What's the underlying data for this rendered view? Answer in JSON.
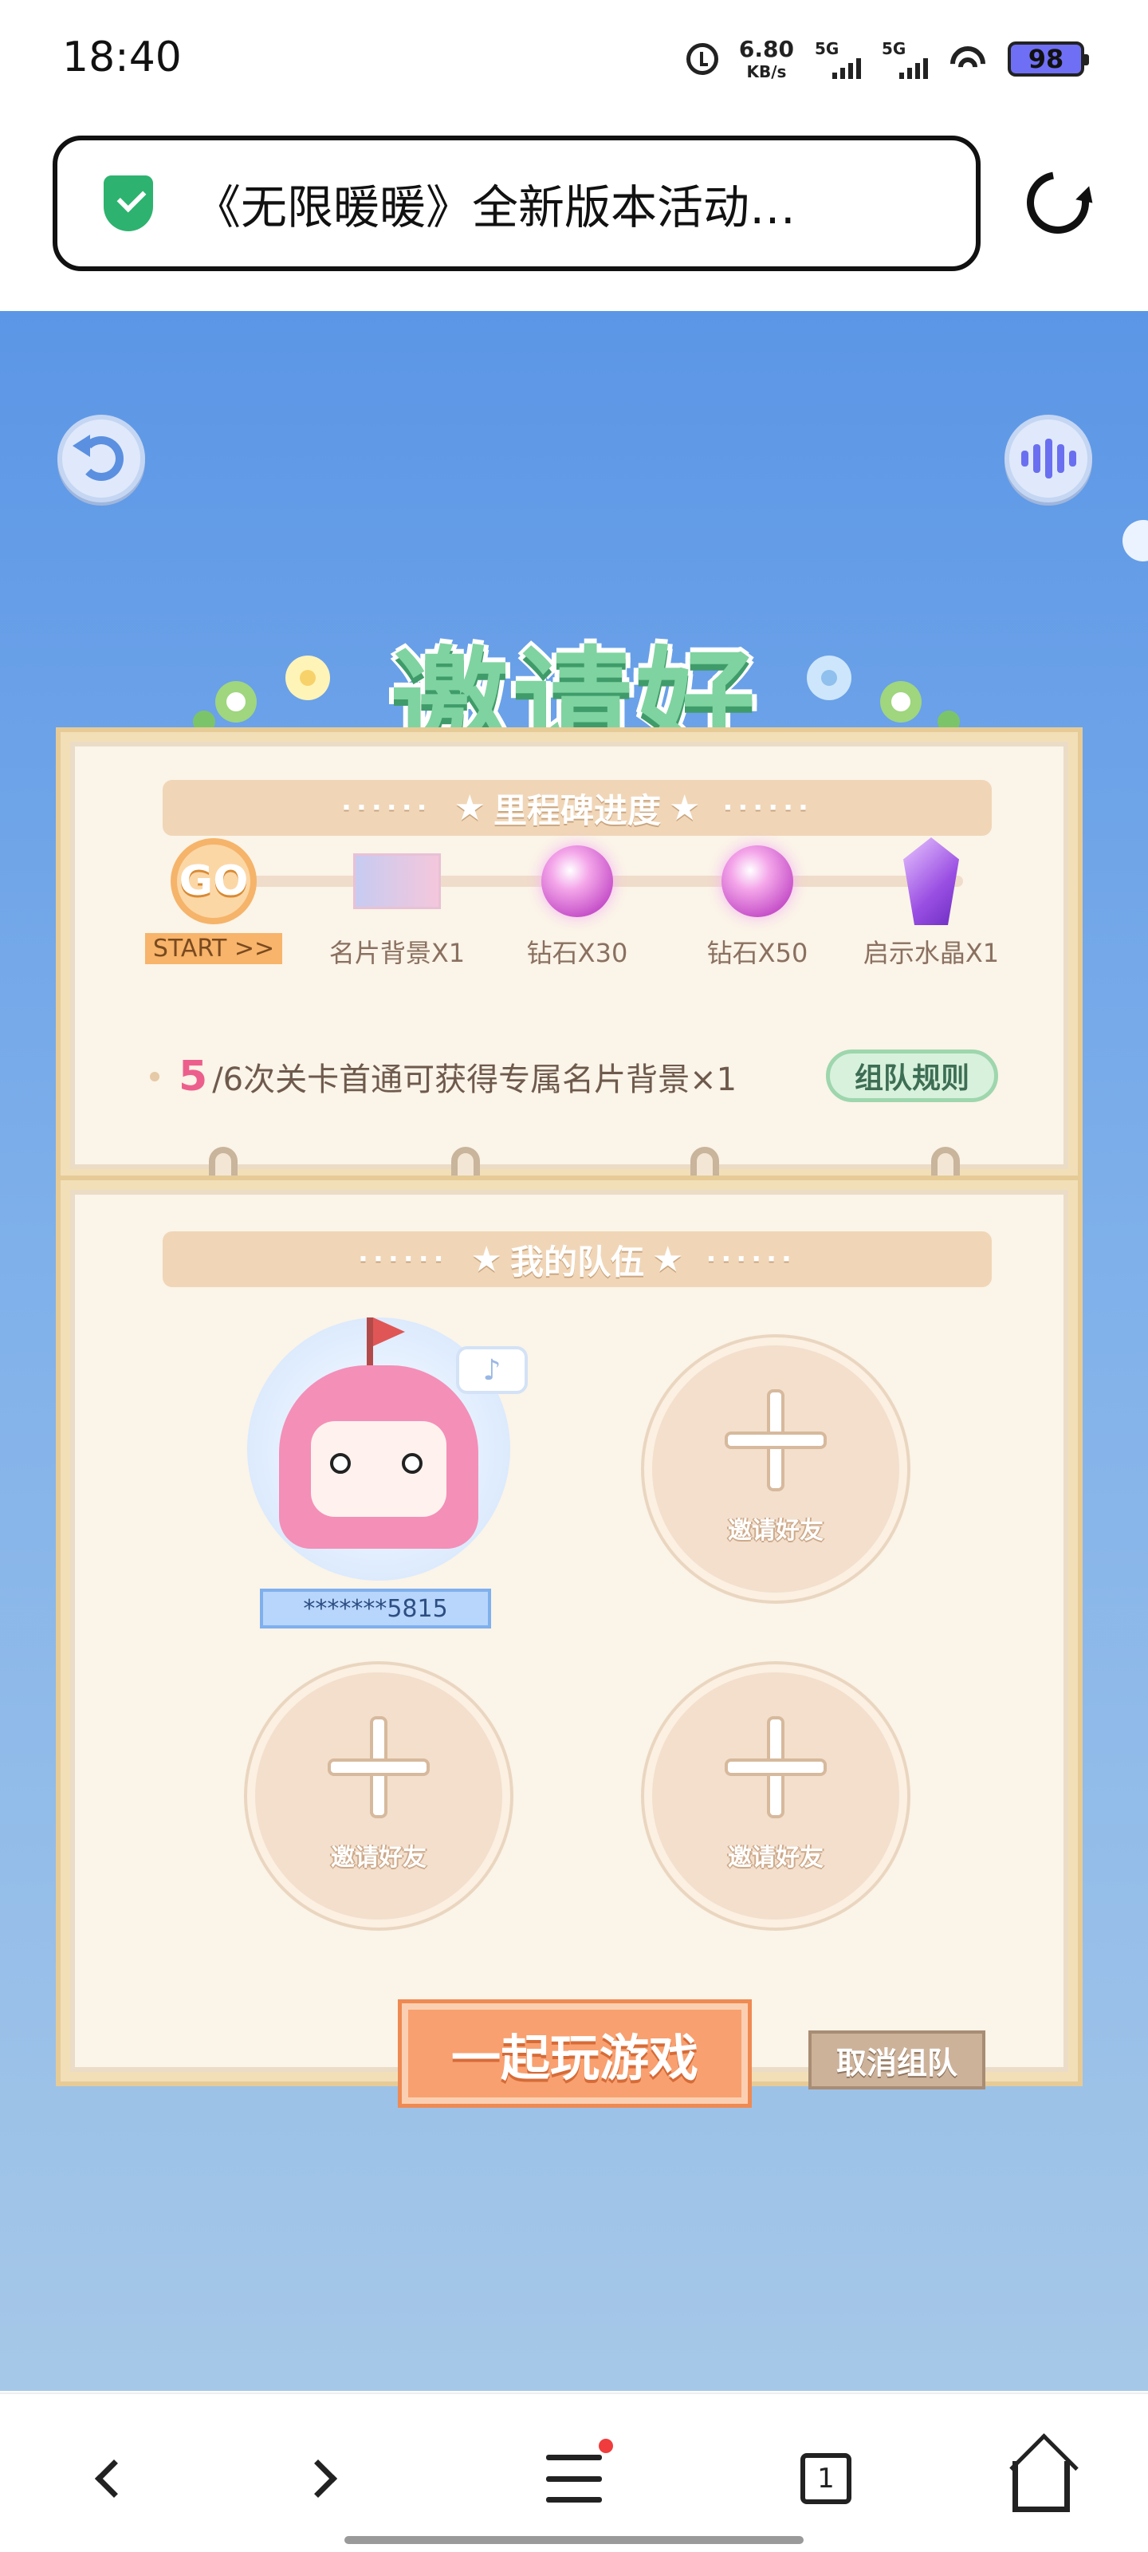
{
  "status_bar": {
    "time": "18:40",
    "net_speed_value": "6.80",
    "net_speed_unit": "KB/s",
    "sim1_label": "5G",
    "sim2_label": "5G",
    "battery": "98"
  },
  "browser": {
    "page_title": "《无限暖暖》全新版本活动…",
    "security_icon": "shield-check-icon",
    "reload_icon": "reload-icon"
  },
  "game": {
    "title": "邀请好友",
    "milestone_section": {
      "heading": "里程碑进度",
      "items": [
        {
          "label": "START >>",
          "icon": "go-badge",
          "badge_text": "GO"
        },
        {
          "label": "名片背景X1",
          "icon": "card-background"
        },
        {
          "label": "钻石X30",
          "icon": "diamond-gem"
        },
        {
          "label": "钻石X50",
          "icon": "diamond-gem"
        },
        {
          "label": "启示水晶X1",
          "icon": "crystal"
        }
      ],
      "progress_current": "5",
      "progress_text": "/6次关卡首通可获得专属名片背景×1",
      "rules_button": "组队规则"
    },
    "team_section": {
      "heading": "我的队伍",
      "member_name": "*******5815",
      "invite_label": "邀请好友"
    },
    "play_button": "一起玩游戏",
    "cancel_button": "取消组队"
  },
  "bottom_nav": {
    "tab_count": "1"
  },
  "colors": {
    "sky_top": "#5b96e6",
    "title_green": "#7fd3a0",
    "play_orange": "#f8a070",
    "progress_pink": "#ec5f8c"
  }
}
